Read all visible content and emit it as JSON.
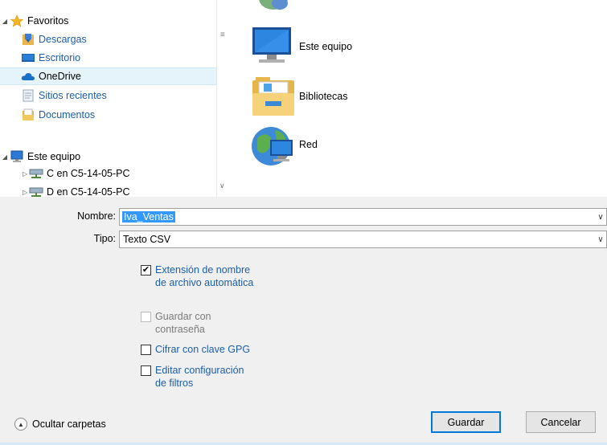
{
  "nav": {
    "favorites_label": "Favoritos",
    "descargas": "Descargas",
    "escritorio": "Escritorio",
    "onedrive": "OneDrive",
    "sitios": "Sitios recientes",
    "documentos": "Documentos",
    "este_equipo": "Este equipo",
    "drive_c": "C en C5-14-05-PC",
    "drive_d": "D en C5-14-05-PC"
  },
  "content": {
    "items": [
      "Este equipo",
      "Bibliotecas",
      "Red"
    ]
  },
  "form": {
    "nombre_label": "Nombre:",
    "nombre_value": "Iva_Ventas",
    "tipo_label": "Tipo:",
    "tipo_value": "Texto CSV"
  },
  "options": {
    "extension": "Extensión de nombre\nde archivo automática",
    "guardar_con": "Guardar con\ncontraseña",
    "cifrar": "Cifrar con clave GPG",
    "editar": "Editar configuración\nde filtros"
  },
  "footer": {
    "hide_folders": "Ocultar carpetas",
    "save": "Guardar",
    "cancel": "Cancelar"
  },
  "colors": {
    "link": "#1c5ea8",
    "selection": "#3399ff",
    "accent": "#0078d7"
  }
}
